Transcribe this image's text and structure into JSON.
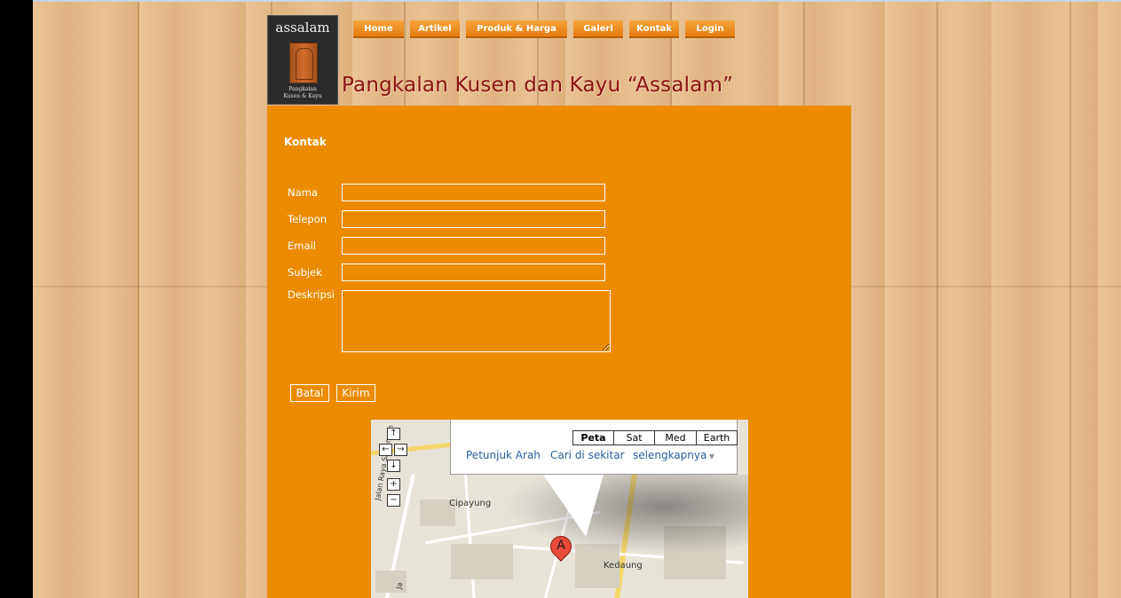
{
  "logo": {
    "word": "assalam",
    "subtitle_line1": "Pangkalan",
    "subtitle_line2": "Kusen & Kayu"
  },
  "nav": {
    "items": [
      {
        "label": "Home"
      },
      {
        "label": "Artikel"
      },
      {
        "label": "Produk & Harga"
      },
      {
        "label": "Galeri"
      },
      {
        "label": "Kontak"
      },
      {
        "label": "Login"
      }
    ]
  },
  "site_title": "Pangkalan Kusen dan Kayu “Assalam”",
  "contact": {
    "heading": "Kontak",
    "fields": {
      "name_label": "Nama",
      "name_value": "",
      "phone_label": "Telepon",
      "phone_value": "",
      "email_label": "Email",
      "email_value": "",
      "subject_label": "Subjek",
      "subject_value": "",
      "description_label": "Deskripsi",
      "description_value": ""
    },
    "buttons": {
      "cancel": "Batal",
      "submit": "Kirim"
    }
  },
  "map": {
    "controls": {
      "up": "↑",
      "left": "←",
      "right": "→",
      "down": "↓",
      "zoom_in": "+",
      "zoom_out": "−"
    },
    "types": [
      "Peta",
      "Sat",
      "Med",
      "Earth"
    ],
    "selected_type": "Peta",
    "links": {
      "directions": "Petunjuk Arah",
      "search_nearby": "Cari di sekitar",
      "more": "selengkapnya"
    },
    "places": {
      "place1": "Cipayung",
      "place2": "Kedaung",
      "road1": "Jalan Raya Sawangan",
      "road2": "Ja"
    },
    "marker_letter": "A"
  }
}
